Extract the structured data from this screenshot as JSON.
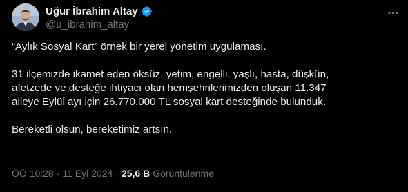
{
  "author": {
    "display_name": "Uğur İbrahim Altay",
    "handle": "@u_ibrahim_altay",
    "verified": true,
    "verified_color": "#1d9bf0"
  },
  "post": {
    "lines": [
      "“Aylık Sosyal Kart” örnek bir yerel yönetim uygulaması.",
      "31 ilçemizde ikamet eden öksüz, yetim, engelli, yaşlı, hasta, düşkün,",
      "afetzede ve desteğe ihtiyacı olan hemşehrilerimizden oluşan 11.347",
      "aileye Eylül ayı için 26.770.000 TL sosyal kart desteğinde bulunduk.",
      "Bereketli olsun, bereketimiz artsın."
    ]
  },
  "meta": {
    "time": "ÖÖ 10:28",
    "separator": "·",
    "date": "11 Eyl 2024",
    "views_count": "25,6 B",
    "views_label": "Görüntülenme"
  },
  "icons": {
    "more": "more-horizontal-icon",
    "verified": "verified-badge-icon",
    "avatar": "avatar"
  },
  "colors": {
    "background": "#000000",
    "text_primary": "#e7e9ea",
    "text_secondary": "#71767b"
  }
}
